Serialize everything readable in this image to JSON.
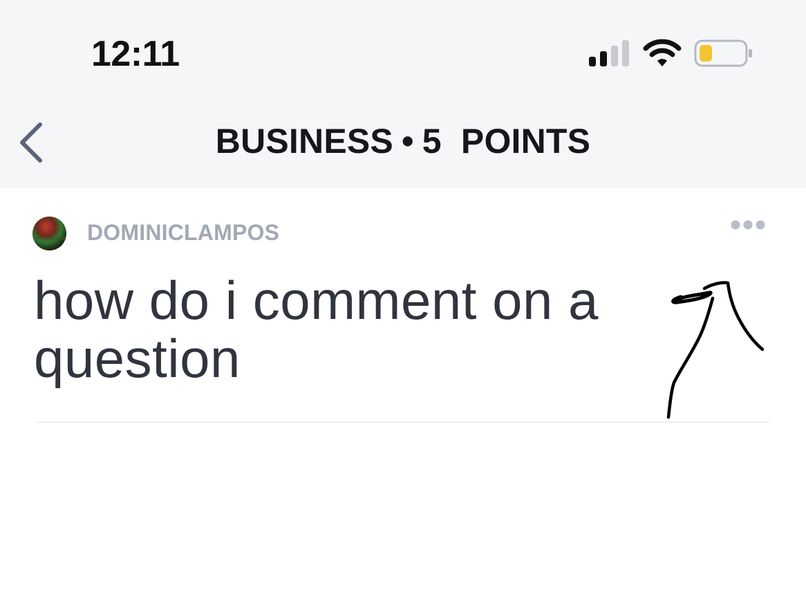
{
  "status_bar": {
    "time": "12:11",
    "icons": [
      "signal-icon",
      "wifi-icon",
      "battery-icon"
    ],
    "battery_color": "#f4c430"
  },
  "nav_bar": {
    "back_icon": "chevron-left-icon",
    "title_left": "BUSINESS",
    "separator": "•",
    "title_right": "5  POINTS",
    "back_icon_color": "#5b6478"
  },
  "post": {
    "username": "DOMINICLAMPOS",
    "more_icon": "more-horizontal-icon",
    "question": "how do i comment on a question"
  },
  "annotation": {
    "type": "handwritten-arrow",
    "color": "#000000"
  }
}
